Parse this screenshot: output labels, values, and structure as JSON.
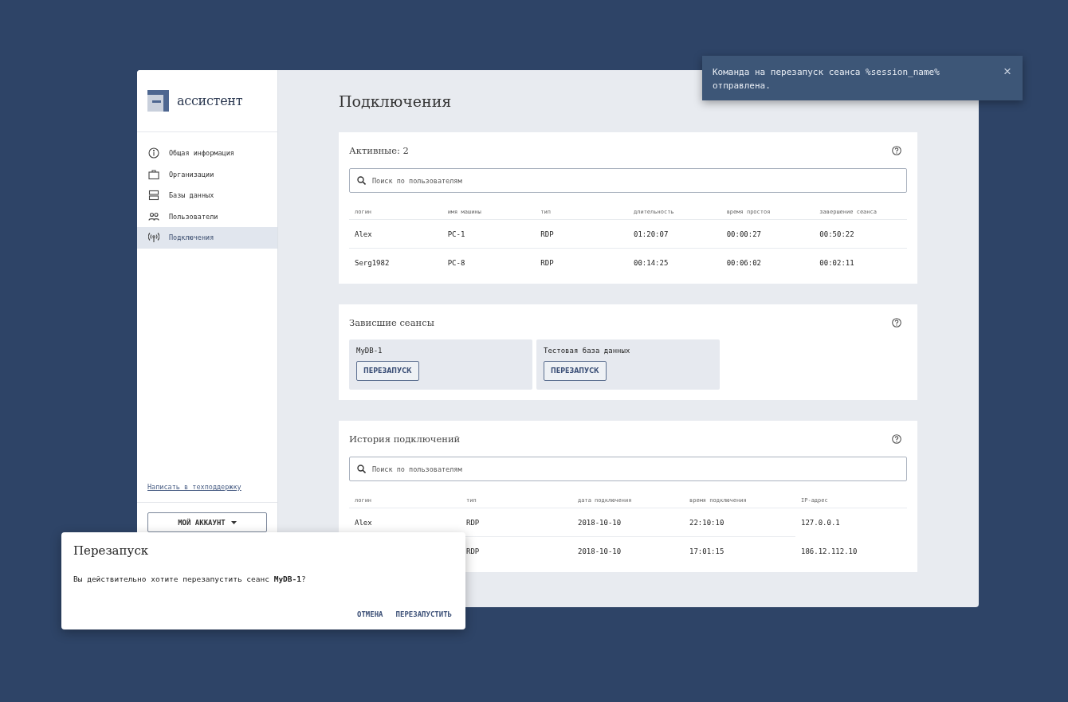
{
  "sidebar": {
    "logo": "ассистент",
    "items": [
      {
        "label": "Общая информация",
        "selected": false
      },
      {
        "label": "Организации",
        "selected": false
      },
      {
        "label": "Базы данных",
        "selected": false
      },
      {
        "label": "Пользователи",
        "selected": false
      },
      {
        "label": "Подключения",
        "selected": true
      }
    ],
    "support_link": "Написать в техподдержку",
    "account_button": "МОЙ АККАУНТ"
  },
  "page_title": "Подключения",
  "active": {
    "title": "Активные: 2",
    "search": {
      "placeholder": "Поиск по пользователям"
    },
    "columns": [
      "логин",
      "имя машины",
      "тип",
      "длительность",
      "время простоя",
      "завершение сеанса"
    ],
    "rows": [
      [
        "Alex",
        "PC-1",
        "RDP",
        "01:20:07",
        "00:00:27",
        "00:50:22"
      ],
      [
        "Serg1982",
        "PC-8",
        "RDP",
        "00:14:25",
        "00:06:02",
        "00:02:11"
      ]
    ]
  },
  "hung": {
    "title": "Зависшие сеансы",
    "sessions": [
      {
        "name": "MyDB-1",
        "button": "ПЕРЕЗАПУСК"
      },
      {
        "name": "Тестовая база данных",
        "button": "ПЕРЕЗАПУСК"
      }
    ]
  },
  "history": {
    "title": "История подключений",
    "search": {
      "placeholder": "Поиск по пользователям"
    },
    "columns": [
      "логин",
      "тип",
      "дата подключения",
      "время подключения",
      "IP-адрес"
    ],
    "rows": [
      [
        "Alex",
        "RDP",
        "2018-10-10",
        "22:10:10",
        "127.0.0.1"
      ],
      [
        null,
        "RDP",
        "2018-10-10",
        "17:01:15",
        "186.12.112.10"
      ]
    ]
  },
  "dialog": {
    "title": "Перезапуск",
    "message": "Вы действительно хотите перезапустить сеанс **MyDB-1**?",
    "buttons": [
      "ОТМЕНА",
      "ПЕРЕЗАПУСТИТЬ"
    ]
  },
  "toast": {
    "message": "Команда на перезапуск сеанса %session_name% отправлена.",
    "close": "×"
  }
}
